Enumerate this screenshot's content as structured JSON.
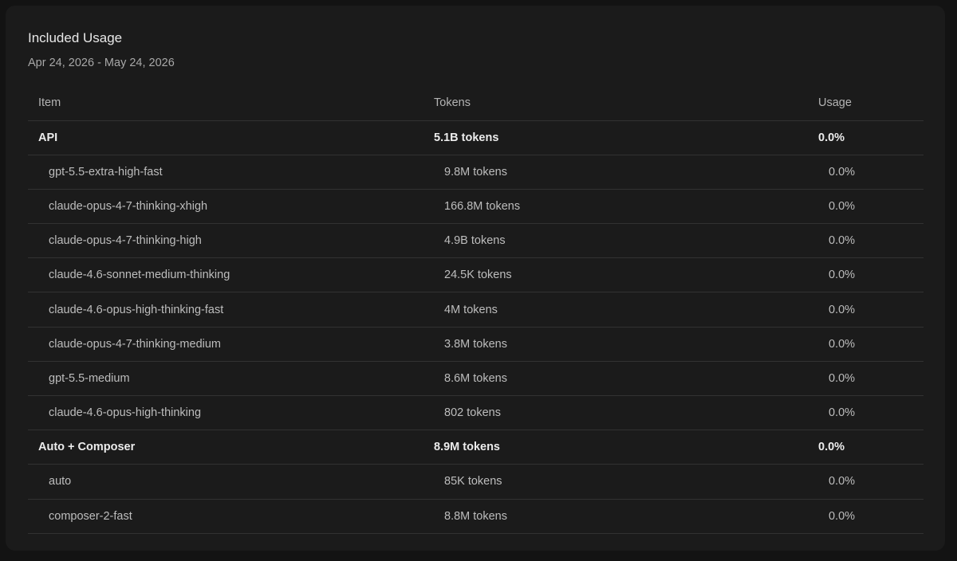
{
  "card": {
    "title": "Included Usage",
    "date_range": "Apr 24, 2026 - May 24, 2026"
  },
  "table": {
    "headers": {
      "item": "Item",
      "tokens": "Tokens",
      "usage": "Usage"
    },
    "rows": [
      {
        "item": "API",
        "tokens": "5.1B tokens",
        "usage": "0.0%",
        "level": "group"
      },
      {
        "item": "gpt-5.5-extra-high-fast",
        "tokens": "9.8M tokens",
        "usage": "0.0%",
        "level": "child"
      },
      {
        "item": "claude-opus-4-7-thinking-xhigh",
        "tokens": "166.8M tokens",
        "usage": "0.0%",
        "level": "child"
      },
      {
        "item": "claude-opus-4-7-thinking-high",
        "tokens": "4.9B tokens",
        "usage": "0.0%",
        "level": "child"
      },
      {
        "item": "claude-4.6-sonnet-medium-thinking",
        "tokens": "24.5K tokens",
        "usage": "0.0%",
        "level": "child"
      },
      {
        "item": "claude-4.6-opus-high-thinking-fast",
        "tokens": "4M tokens",
        "usage": "0.0%",
        "level": "child"
      },
      {
        "item": "claude-opus-4-7-thinking-medium",
        "tokens": "3.8M tokens",
        "usage": "0.0%",
        "level": "child"
      },
      {
        "item": "gpt-5.5-medium",
        "tokens": "8.6M tokens",
        "usage": "0.0%",
        "level": "child"
      },
      {
        "item": "claude-4.6-opus-high-thinking",
        "tokens": "802 tokens",
        "usage": "0.0%",
        "level": "child"
      },
      {
        "item": "Auto + Composer",
        "tokens": "8.9M tokens",
        "usage": "0.0%",
        "level": "group"
      },
      {
        "item": "auto",
        "tokens": "85K tokens",
        "usage": "0.0%",
        "level": "child"
      },
      {
        "item": "composer-2-fast",
        "tokens": "8.8M tokens",
        "usage": "0.0%",
        "level": "child"
      }
    ]
  },
  "colors": {
    "page_background": "#131313",
    "card_background": "#1b1b1b",
    "divider": "#323232",
    "primary_text": "#ececec",
    "secondary_text": "#bdbdbd"
  }
}
